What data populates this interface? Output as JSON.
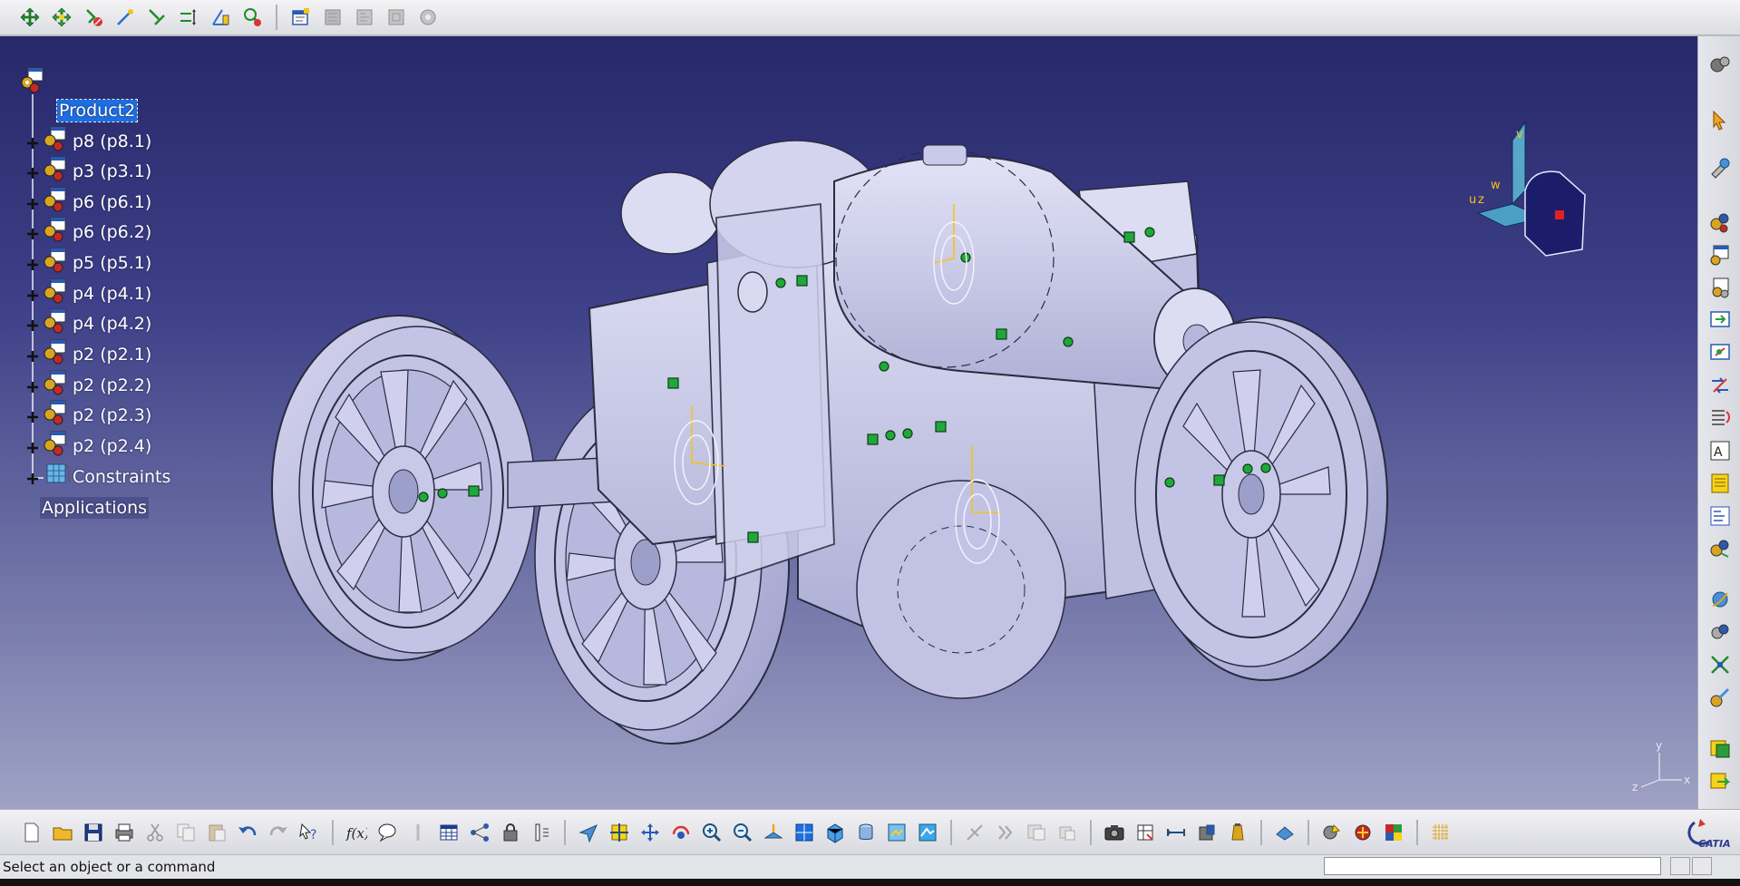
{
  "app": {
    "name": "CATIA"
  },
  "tree": {
    "root": "Product2",
    "items": [
      {
        "label": "p8 (p8.1)"
      },
      {
        "label": "p3 (p3.1)"
      },
      {
        "label": "p6 (p6.1)"
      },
      {
        "label": "p6 (p6.2)"
      },
      {
        "label": "p5 (p5.1)"
      },
      {
        "label": "p4 (p4.1)"
      },
      {
        "label": "p4 (p4.2)"
      },
      {
        "label": "p2 (p2.1)"
      },
      {
        "label": "p2 (p2.2)"
      },
      {
        "label": "p2 (p2.3)"
      },
      {
        "label": "p2 (p2.4)"
      }
    ],
    "constraints": "Constraints",
    "applications": "Applications"
  },
  "compass": {
    "u": "u",
    "v": "v",
    "w": "w",
    "z": "z"
  },
  "axis_triad": {
    "x": "x",
    "y": "y",
    "z": "z"
  },
  "status": {
    "message": "Select an object or a command",
    "command_value": ""
  },
  "brand": {
    "logo_text": "CATIA"
  },
  "colors": {
    "viewport_top": "#27286a",
    "viewport_bottom": "#9fa2c4",
    "selection": "#1c6fe0",
    "compass_yellow": "#f2c51a",
    "constraint_green": "#1fa83a",
    "model_fill": "#c9c9ea"
  },
  "toolbars": {
    "top": [
      "manipulation-icon",
      "snap-icon",
      "fix-icon",
      "coincidence-icon",
      "contact-icon",
      "offset-icon",
      "angle-icon",
      "fix-together-icon",
      "insert-component-icon",
      "product-icon",
      "part-icon",
      "existing-component-icon",
      "replace-icon"
    ],
    "bottom": [
      "new-icon",
      "open-icon",
      "save-icon",
      "print-icon",
      "cut-icon",
      "copy-icon",
      "paste-icon",
      "undo-icon",
      "redo-icon",
      "whats-this-icon",
      "formula-icon",
      "comment-icon",
      "knowledge-icon",
      "table-icon",
      "graph-icon",
      "lock-icon",
      "parameters-icon",
      "fly-icon",
      "fit-all-icon",
      "pan-icon",
      "rotate-icon",
      "zoom-in-icon",
      "zoom-out-icon",
      "normal-view-icon",
      "quick-view-icon",
      "iso-view-icon",
      "hide-show-icon",
      "swap-visible-icon",
      "render-icon",
      "update-icon",
      "reorder-icon",
      "capture-icon",
      "measure-icon",
      "measure-between-icon",
      "measure-item-icon",
      "weight-icon",
      "catalog-icon",
      "clash-icon",
      "sectioning-icon",
      "snapshot-icon",
      "grid-icon"
    ],
    "right": [
      "catalog-icon",
      "select-icon",
      "tools-icon",
      "component-icon",
      "product-icon",
      "part-icon",
      "existing-icon",
      "multi-instance-icon",
      "replace-icon",
      "reorder-icon",
      "generate-numbering-icon",
      "bill-of-material-icon",
      "explode-icon",
      "scene-icon",
      "publish-icon",
      "manipulate-icon",
      "snap-icon",
      "smart-move-icon",
      "flexible-icon",
      "fixed-icon",
      "constraint-icon"
    ]
  }
}
